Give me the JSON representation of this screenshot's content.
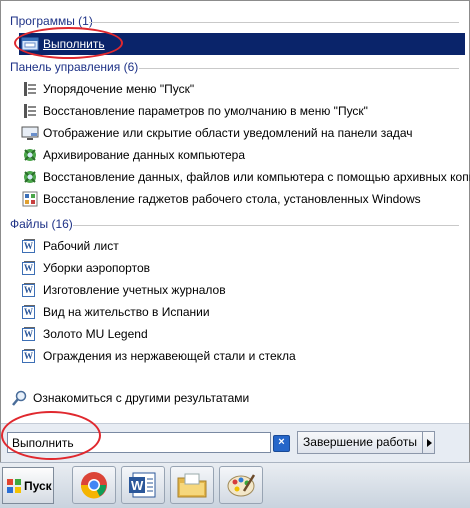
{
  "groups": {
    "programs": "Программы (1)",
    "control_panel": "Панель управления (6)",
    "files": "Файлы (16)"
  },
  "programs": [
    "Выполнить"
  ],
  "control_panel": [
    "Упорядочение меню \"Пуск\"",
    "Восстановление параметров по умолчанию в меню \"Пуск\"",
    "Отображение или скрытие области уведомлений на панели задач",
    "Архивирование данных компьютера",
    "Восстановление данных, файлов или компьютера с помощью архивных копий",
    "Восстановление гаджетов рабочего стола, установленных Windows"
  ],
  "files": [
    "Рабочий лист",
    "Уборки аэропортов",
    "Изготовление учетных журналов",
    "Вид на жительство в Испании",
    "Золото MU Legend",
    "Ограждения из нержавеющей стали и стекла"
  ],
  "more_results": "Ознакомиться с другими результатами",
  "search_value": "Выполнить",
  "shutdown_label": "Завершение работы",
  "start_label": "Пуск",
  "icons": {
    "run": "run-icon",
    "start_menu": "start-menu-settings-icon",
    "notification": "notification-area-icon",
    "backup": "backup-icon",
    "gadgets": "gadgets-icon",
    "word_doc": "word-document-icon",
    "search": "magnifier-icon",
    "clear": "clear-search-icon",
    "chrome": "chrome-icon",
    "word": "word-icon",
    "explorer": "explorer-folder-icon",
    "paint": "paint-icon"
  },
  "colors": {
    "selection": "#0a246a",
    "group_title": "#1e3287",
    "annotation": "#e0282e"
  }
}
